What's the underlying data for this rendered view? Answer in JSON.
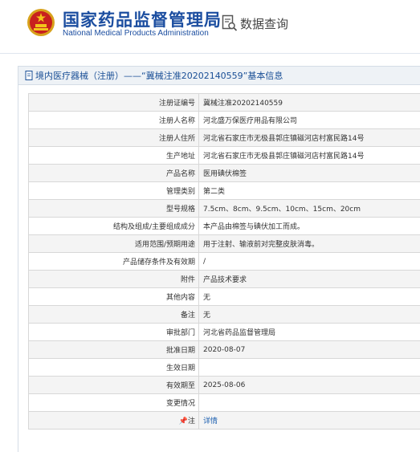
{
  "header": {
    "title_cn": "国家药品监督管理局",
    "title_en": "National Medical Products Administration",
    "query_label": "数据查询",
    "emblem_icon": "national-emblem-icon",
    "query_icon": "document-search-icon"
  },
  "panel": {
    "title": "境内医疗器械（注册）——“冀械注准20202140559”基本信息",
    "icon": "document-icon"
  },
  "rows": [
    {
      "label": "注册证编号",
      "value": "冀械注准20202140559"
    },
    {
      "label": "注册人名称",
      "value": "河北盛万保医疗用品有限公司"
    },
    {
      "label": "注册人住所",
      "value": "河北省石家庄市无极县郭庄镇磁河店村富民路14号"
    },
    {
      "label": "生产地址",
      "value": "河北省石家庄市无极县郭庄镇磁河店村富民路14号"
    },
    {
      "label": "产品名称",
      "value": "医用碘伏棉签"
    },
    {
      "label": "管理类别",
      "value": "第二类"
    },
    {
      "label": "型号规格",
      "value": "7.5cm、8cm、9.5cm、10cm、15cm、20cm"
    },
    {
      "label": "结构及组成/主要组成成分",
      "value": "本产品由棉签与碘伏加工而成。"
    },
    {
      "label": "适用范围/预期用途",
      "value": "用于注射、输液前对完整皮肤消毒。"
    },
    {
      "label": "产品储存条件及有效期",
      "value": "/"
    },
    {
      "label": "附件",
      "value": "产品技术要求"
    },
    {
      "label": "其他内容",
      "value": "无"
    },
    {
      "label": "备注",
      "value": "无"
    },
    {
      "label": "审批部门",
      "value": "河北省药品监督管理局"
    },
    {
      "label": "批准日期",
      "value": "2020-08-07"
    },
    {
      "label": "生效日期",
      "value": ""
    },
    {
      "label": "有效期至",
      "value": "2025-08-06"
    },
    {
      "label": "变更情况",
      "value": ""
    },
    {
      "label": "注",
      "value": "详情",
      "label_icon": "pin-icon"
    }
  ]
}
